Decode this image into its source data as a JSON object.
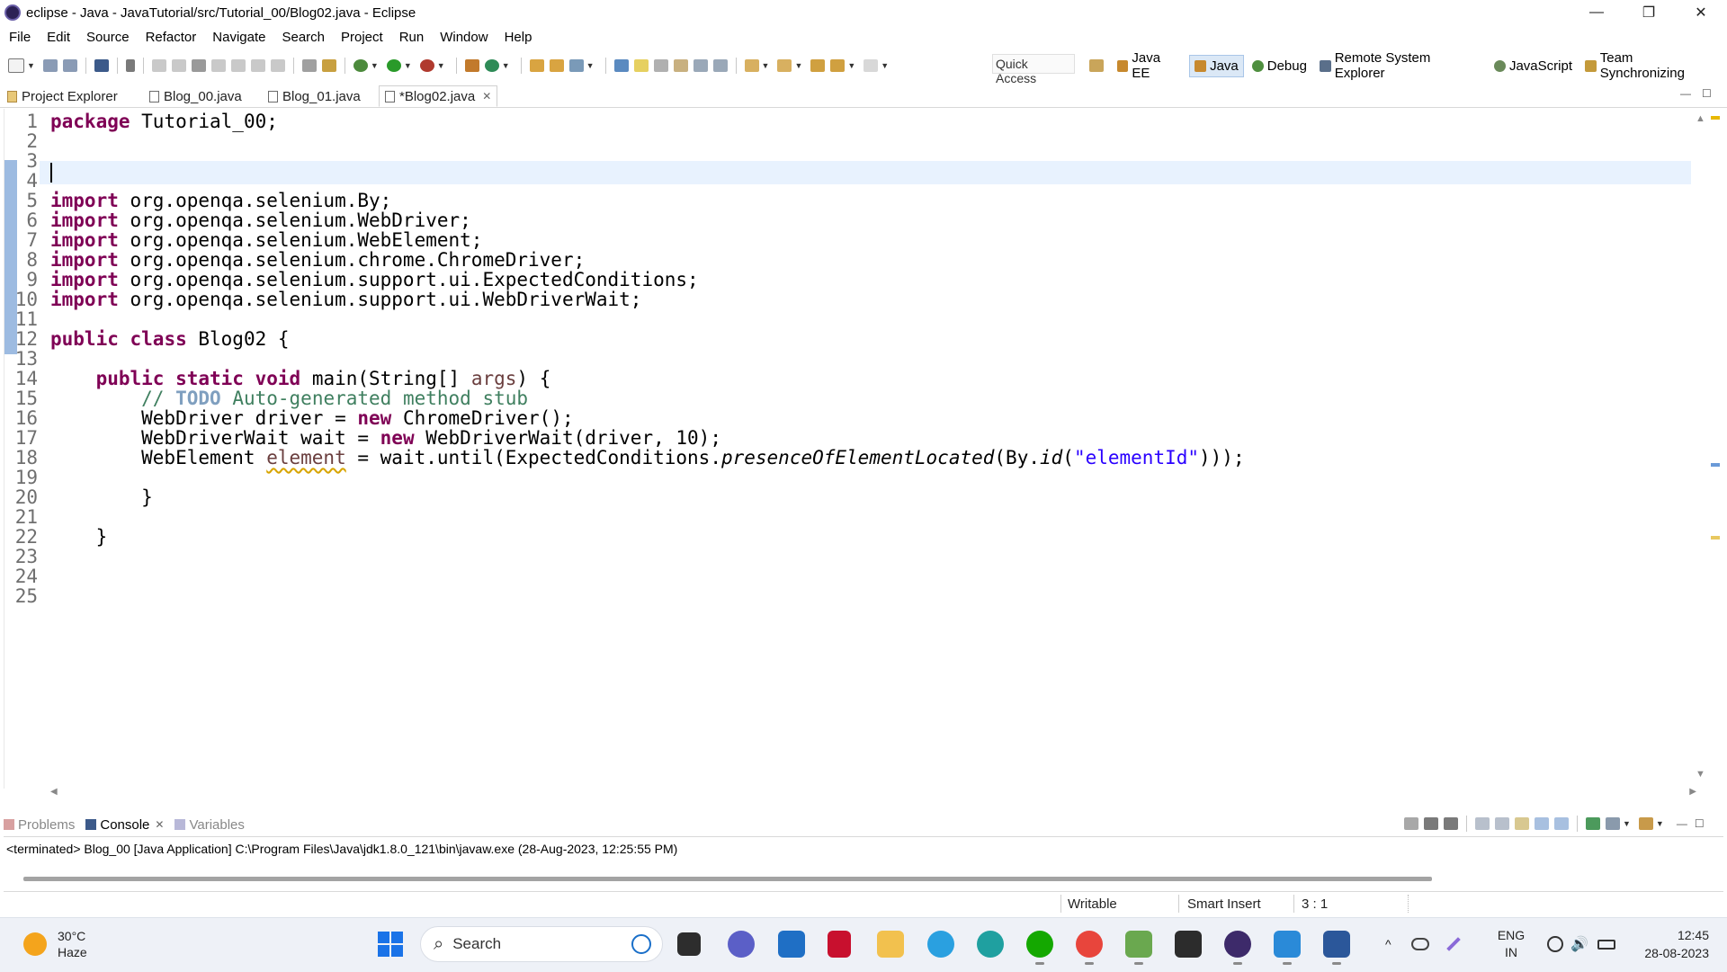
{
  "window": {
    "title": "eclipse - Java - JavaTutorial/src/Tutorial_00/Blog02.java - Eclipse",
    "minimize": "—",
    "restore": "❐",
    "close": "✕"
  },
  "menu": [
    "File",
    "Edit",
    "Source",
    "Refactor",
    "Navigate",
    "Search",
    "Project",
    "Run",
    "Window",
    "Help"
  ],
  "toolbar": {
    "quick_access": "Quick Access",
    "perspectives": [
      {
        "label": "Java EE",
        "active": false,
        "icon": "java-ee-icon"
      },
      {
        "label": "Java",
        "active": true,
        "icon": "java-icon"
      },
      {
        "label": "Debug",
        "active": false,
        "icon": "debug-icon"
      },
      {
        "label": "Remote System Explorer",
        "active": false,
        "icon": "remote-system-icon"
      },
      {
        "label": "JavaScript",
        "active": false,
        "icon": "javascript-icon"
      },
      {
        "label": "Team Synchronizing",
        "active": false,
        "icon": "team-sync-icon"
      }
    ]
  },
  "tabs": [
    {
      "label": "Project Explorer",
      "active": false
    },
    {
      "label": "Blog_00.java",
      "active": false
    },
    {
      "label": "Blog_01.java",
      "active": false
    },
    {
      "label": "*Blog02.java",
      "active": true
    }
  ],
  "editor": {
    "lines": [
      {
        "n": "1",
        "text": "package Tutorial_00;"
      },
      {
        "n": "2",
        "text": ""
      },
      {
        "n": "3",
        "text": ""
      },
      {
        "n": "4",
        "text": ""
      },
      {
        "n": "5",
        "text": "import org.openqa.selenium.By;"
      },
      {
        "n": "6",
        "text": "import org.openqa.selenium.WebDriver;"
      },
      {
        "n": "7",
        "text": "import org.openqa.selenium.WebElement;"
      },
      {
        "n": "8",
        "text": "import org.openqa.selenium.chrome.ChromeDriver;"
      },
      {
        "n": "9",
        "text": "import org.openqa.selenium.support.ui.ExpectedConditions;"
      },
      {
        "n": "10",
        "text": "import org.openqa.selenium.support.ui.WebDriverWait;"
      },
      {
        "n": "11",
        "text": ""
      },
      {
        "n": "12",
        "text": "public class Blog02 {"
      },
      {
        "n": "13",
        "text": ""
      },
      {
        "n": "14",
        "text": "    public static void main(String[] args) {"
      },
      {
        "n": "15",
        "text": "        // TODO Auto-generated method stub"
      },
      {
        "n": "16",
        "text": "        WebDriver driver = new ChromeDriver();"
      },
      {
        "n": "17",
        "text": "        WebDriverWait wait = new WebDriverWait(driver, 10);"
      },
      {
        "n": "18",
        "text": "        WebElement element = wait.until(ExpectedConditions.presenceOfElementLocated(By.id(\"elementId\")));"
      },
      {
        "n": "19",
        "text": ""
      },
      {
        "n": "20",
        "text": "        }"
      },
      {
        "n": "21",
        "text": ""
      },
      {
        "n": "22",
        "text": "    }"
      },
      {
        "n": "23",
        "text": ""
      },
      {
        "n": "24",
        "text": ""
      },
      {
        "n": "25",
        "text": ""
      }
    ]
  },
  "console": {
    "tabs": [
      {
        "label": "Problems",
        "active": false
      },
      {
        "label": "Console",
        "active": true
      },
      {
        "label": "Variables",
        "active": false
      }
    ],
    "output": "<terminated> Blog_00 [Java Application] C:\\Program Files\\Java\\jdk1.8.0_121\\bin\\javaw.exe (28-Aug-2023, 12:25:55 PM)"
  },
  "statusbar": {
    "writable": "Writable",
    "insert_mode": "Smart Insert",
    "position": "3 : 1"
  },
  "taskbar": {
    "weather_temp": "30°C",
    "weather_desc": "Haze",
    "search_label": "Search",
    "lang_top": "ENG",
    "lang_bottom": "IN",
    "time": "12:45",
    "date": "28-08-2023"
  },
  "colors": {
    "keyword": "#7f0055",
    "comment": "#3f7f5f",
    "string": "#2a00ff",
    "current_line": "#e8f2fe",
    "accent": "#1a73e8"
  }
}
